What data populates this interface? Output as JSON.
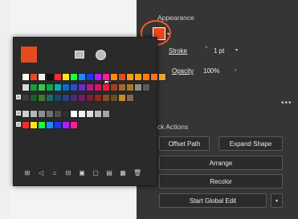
{
  "properties_panel": {
    "appearance_title": "Appearance",
    "fill_color": "#e84a1f",
    "fill_highlight_color": "#ef5a28",
    "stroke_label": "Stroke",
    "stroke_value": "1 pt",
    "opacity_label": "Opacity",
    "opacity_value": "100%",
    "more_options_label": "•••",
    "quick_actions_title": "ck Actions",
    "buttons": {
      "offset_path": "Offset Path",
      "expand_shape": "Expand Shape",
      "arrange": "Arrange",
      "recolor": "Recolor",
      "start_global_edit": "Start Global Edit"
    }
  },
  "swatches_panel": {
    "current_fill": "#e84a1f",
    "icons": {
      "image_swatch": "image-swatch-icon",
      "color_wheel": "color-wheel-icon",
      "cursor": "cursor-arrow-icon"
    },
    "rows": [
      [
        "#ffffff",
        "#e84a1f",
        "#f0f0f0",
        "#111111",
        "#ff2a2a",
        "#ffe22a",
        "#19ff3a",
        "#1d8bff",
        "#1b39ff",
        "#b01dff",
        "#ff1d99",
        "#ff8c1a",
        "#e34e1d",
        "#ff9a1f",
        "#ff9a00",
        "#ff7a13",
        "#f46f2d",
        "#f0a02d"
      ],
      [
        "#d9d9d9",
        "#1f9a3b",
        "#3ec44b",
        "#10a64a",
        "#0ea9b6",
        "#0d6bc6",
        "#2d4ad2",
        "#6d2cc6",
        "#b7198b",
        "#d9145b",
        "#e1233d",
        "#a83c2a",
        "#a9672e",
        "#a8792b",
        "#8e8e8e",
        "#5b5b5b"
      ],
      [
        "#3d3d3d",
        "#1b5f2a",
        "#3f7a2b",
        "#1f6b5f",
        "#144a6b",
        "#2e3f84",
        "#4a2b7a",
        "#6f1f5f",
        "#7a1f35",
        "#8a2a24",
        "#8b4a20",
        "#6a4e25",
        "#c58b2b",
        "#7e6b4b"
      ],
      [
        "#cfcfcf",
        "#b8b8b8",
        "#8f8f8f",
        "#6f6f6f",
        "#4f4f4f",
        "#2f2f2f",
        "#ffffff",
        "#f2f2f2",
        "#dedede",
        "#bcbcbc",
        "#a3a3a3"
      ],
      [
        "#ff2a2a",
        "#ffe22a",
        "#19ff3a",
        "#1d8bff",
        "#1b39ff",
        "#b01dff",
        "#ff1d99"
      ]
    ],
    "toolbar_icons": [
      "library-icon",
      "show-kinds-icon",
      "swatch-options-icon",
      "new-group-icon",
      "new-swatch-icon",
      "delete-swatch-icon",
      "folder-icon",
      "page-icon",
      "trash-icon"
    ]
  }
}
